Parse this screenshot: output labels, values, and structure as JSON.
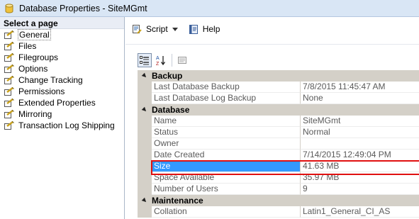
{
  "window": {
    "title": "Database Properties - SiteMGmt",
    "icon": "database-icon"
  },
  "sidebar": {
    "header": "Select a page",
    "items": [
      {
        "label": "General",
        "selected": true
      },
      {
        "label": "Files"
      },
      {
        "label": "Filegroups"
      },
      {
        "label": "Options"
      },
      {
        "label": "Change Tracking"
      },
      {
        "label": "Permissions"
      },
      {
        "label": "Extended Properties"
      },
      {
        "label": "Mirroring"
      },
      {
        "label": "Transaction Log Shipping"
      }
    ]
  },
  "toolbar": {
    "script_label": "Script",
    "help_label": "Help"
  },
  "properties": {
    "backup": {
      "title": "Backup",
      "rows": [
        {
          "name": "Last Database Backup",
          "value": "7/8/2015 11:45:47 AM"
        },
        {
          "name": "Last Database Log Backup",
          "value": "None"
        }
      ]
    },
    "database": {
      "title": "Database",
      "rows": [
        {
          "name": "Name",
          "value": "SiteMGmt"
        },
        {
          "name": "Status",
          "value": "Normal"
        },
        {
          "name": "Owner",
          "value": ""
        },
        {
          "name": "Date Created",
          "value": "7/14/2015 12:49:04 PM"
        },
        {
          "name": "Size",
          "value": "41.63 MB"
        },
        {
          "name": "Space Available",
          "value": "35.97 MB"
        },
        {
          "name": "Number of Users",
          "value": "9"
        }
      ]
    },
    "maintenance": {
      "title": "Maintenance",
      "rows": [
        {
          "name": "Collation",
          "value": "Latin1_General_CI_AS"
        }
      ]
    }
  },
  "colors": {
    "selection": "#3399ff",
    "highlight_border": "#e01010",
    "category_bg": "#d4d0c8"
  }
}
